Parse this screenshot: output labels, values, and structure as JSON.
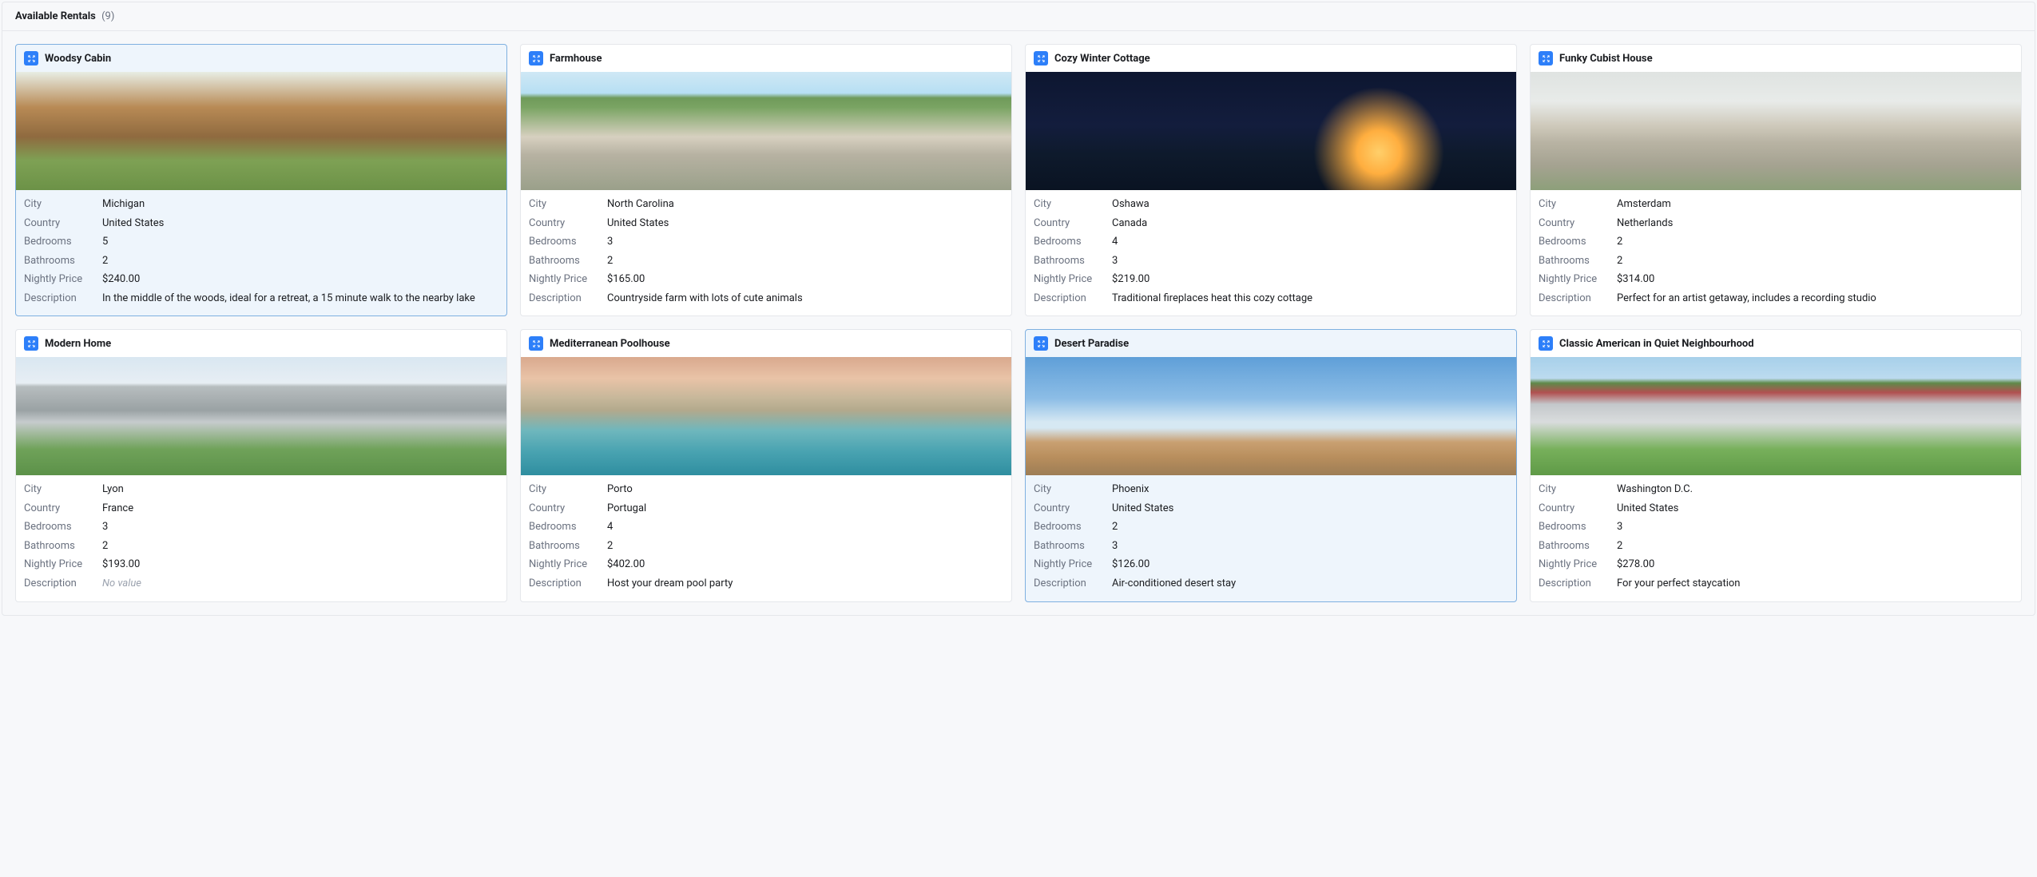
{
  "header": {
    "title": "Available Rentals",
    "count": "(9)"
  },
  "field_labels": {
    "city": "City",
    "country": "Country",
    "bedrooms": "Bedrooms",
    "bathrooms": "Bathrooms",
    "nightly_price": "Nightly Price",
    "description": "Description"
  },
  "no_value_text": "No value",
  "cards": [
    {
      "title": "Woodsy Cabin",
      "selected": true,
      "image_class": "img-woodsy-cabin",
      "city": "Michigan",
      "country": "United States",
      "bedrooms": "5",
      "bathrooms": "2",
      "nightly_price": "$240.00",
      "description": "In the middle of the woods, ideal for a retreat, a 15 minute walk to the nearby lake"
    },
    {
      "title": "Farmhouse",
      "selected": false,
      "image_class": "img-farmhouse",
      "city": "North Carolina",
      "country": "United States",
      "bedrooms": "3",
      "bathrooms": "2",
      "nightly_price": "$165.00",
      "description": "Countryside farm with lots of cute animals"
    },
    {
      "title": "Cozy Winter Cottage",
      "selected": false,
      "image_class": "img-cozy-winter-cottage",
      "city": "Oshawa",
      "country": "Canada",
      "bedrooms": "4",
      "bathrooms": "3",
      "nightly_price": "$219.00",
      "description": "Traditional fireplaces heat this cozy cottage"
    },
    {
      "title": "Funky Cubist House",
      "selected": false,
      "image_class": "img-funky-cubist-house",
      "city": "Amsterdam",
      "country": "Netherlands",
      "bedrooms": "2",
      "bathrooms": "2",
      "nightly_price": "$314.00",
      "description": "Perfect for an artist getaway, includes a recording studio"
    },
    {
      "title": "Modern Home",
      "selected": false,
      "image_class": "img-modern-home",
      "city": "Lyon",
      "country": "France",
      "bedrooms": "3",
      "bathrooms": "2",
      "nightly_price": "$193.00",
      "description": null
    },
    {
      "title": "Mediterranean Poolhouse",
      "selected": false,
      "image_class": "img-mediterranean-poolhouse",
      "city": "Porto",
      "country": "Portugal",
      "bedrooms": "4",
      "bathrooms": "2",
      "nightly_price": "$402.00",
      "description": "Host your dream pool party"
    },
    {
      "title": "Desert Paradise",
      "selected": true,
      "image_class": "img-desert-paradise",
      "city": "Phoenix",
      "country": "United States",
      "bedrooms": "2",
      "bathrooms": "3",
      "nightly_price": "$126.00",
      "description": "Air-conditioned desert stay"
    },
    {
      "title": "Classic American in Quiet Neighbourhood",
      "selected": false,
      "image_class": "img-classic-american",
      "city": "Washington D.C.",
      "country": "United States",
      "bedrooms": "3",
      "bathrooms": "2",
      "nightly_price": "$278.00",
      "description": "For your perfect staycation"
    }
  ]
}
